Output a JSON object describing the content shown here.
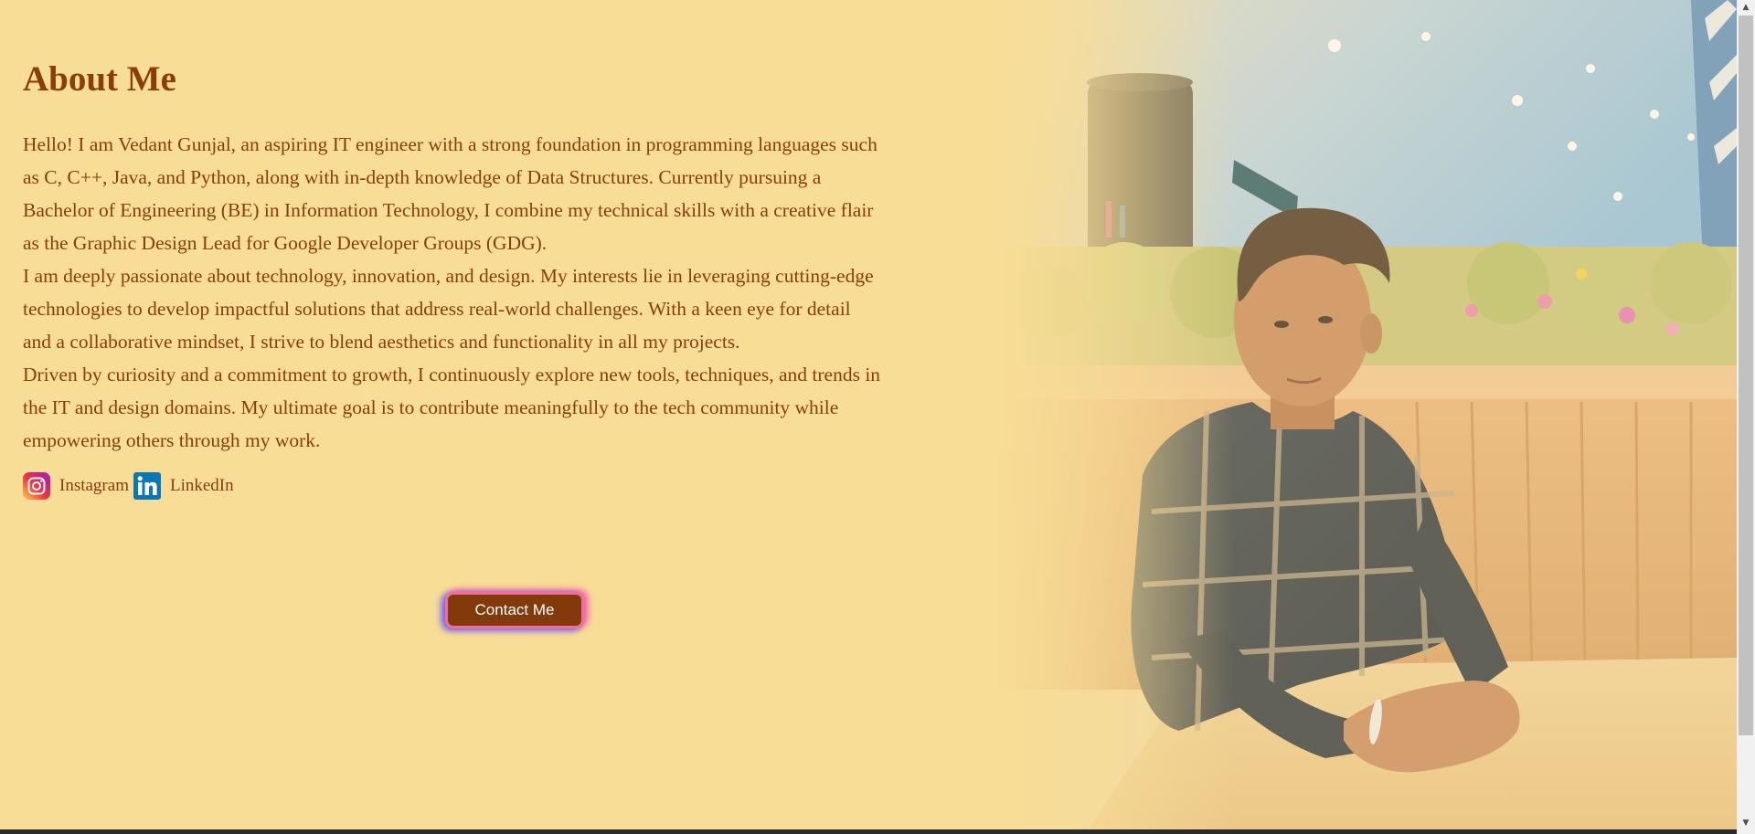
{
  "about": {
    "heading": "About Me",
    "paragraphs": [
      "Hello! I am Vedant Gunjal, an aspiring IT engineer with a strong foundation in programming languages such as C, C++, Java, and Python, along with in-depth knowledge of Data Structures. Currently pursuing a Bachelor of Engineering (BE) in Information Technology, I combine my technical skills with a creative flair as the Graphic Design Lead for Google Developer Groups (GDG).",
      "I am deeply passionate about technology, innovation, and design. My interests lie in leveraging cutting-edge technologies to develop impactful solutions that address real-world challenges. With a keen eye for detail and a collaborative mindset, I strive to blend aesthetics and functionality in all my projects.",
      "Driven by curiosity and a commitment to growth, I continuously explore new tools, techniques, and trends in the IT and design domains. My ultimate goal is to contribute meaningfully to the tech community while empowering others through my work."
    ],
    "socials": [
      {
        "label": "Instagram",
        "icon": "instagram-icon"
      },
      {
        "label": "LinkedIn",
        "icon": "linkedin-icon"
      }
    ],
    "contact_label": "Contact Me"
  },
  "colors": {
    "background": "#f8dd96",
    "text": "#8a3c0b",
    "button": "#833a0b",
    "button_border": "#ee6f97"
  },
  "scrollbar": {
    "up_arrow": "▲",
    "down_arrow": "▼"
  }
}
